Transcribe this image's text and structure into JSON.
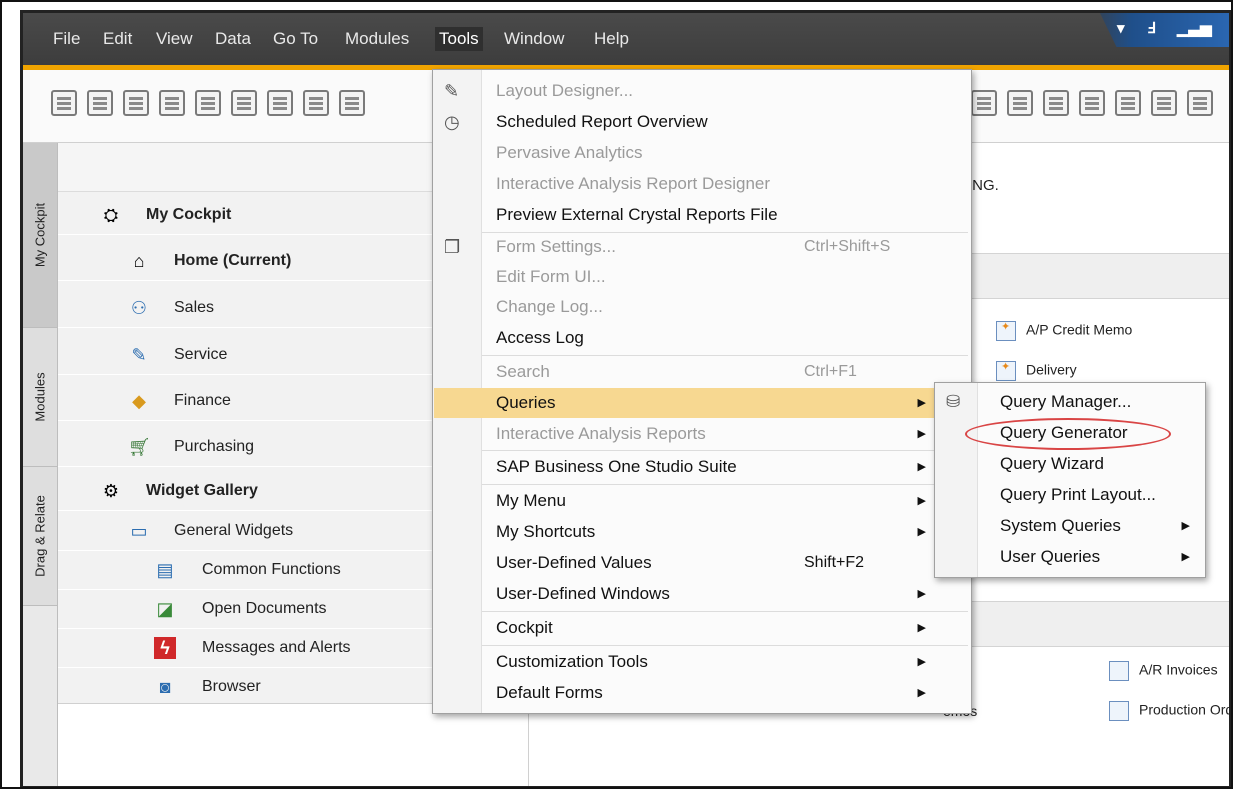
{
  "menubar": {
    "items": [
      "File",
      "Edit",
      "View",
      "Data",
      "Go To",
      "Modules",
      "Tools",
      "Window",
      "Help"
    ],
    "open_item": "Tools"
  },
  "toolbar_icons": [
    "print-preview-icon",
    "print-icon",
    "email-icon",
    "export-icon",
    "calculator-icon",
    "excel-export-icon",
    "word-export-icon",
    "pdf-export-icon",
    "launch-icon"
  ],
  "side_tabs": [
    "My Cockpit",
    "Modules",
    "Drag & Relate"
  ],
  "cockpit": {
    "title": "My Cockpit",
    "items": [
      {
        "label": "Home (Current)",
        "icon": "home-icon",
        "bold": true
      },
      {
        "label": "Sales",
        "icon": "sales-icon"
      },
      {
        "label": "Service",
        "icon": "service-icon"
      },
      {
        "label": "Finance",
        "icon": "finance-icon"
      },
      {
        "label": "Purchasing",
        "icon": "purchasing-icon"
      }
    ],
    "widget_gallery": "Widget Gallery",
    "general_widgets": "General Widgets",
    "widgets": [
      {
        "label": "Common Functions",
        "icon": "common-functions-icon"
      },
      {
        "label": "Open Documents",
        "icon": "open-documents-icon"
      },
      {
        "label": "Messages and Alerts",
        "icon": "messages-alerts-icon"
      },
      {
        "label": "Browser",
        "icon": "browser-icon"
      }
    ]
  },
  "content": {
    "notice": "AINING.",
    "docs": [
      "A/P Credit Memo",
      "Delivery",
      "A/R Invoices",
      "emos",
      "Production Ord"
    ]
  },
  "tools_menu": [
    {
      "label": "Layout Designer...",
      "disabled": true,
      "icon": "layout-designer-icon"
    },
    {
      "label": "Scheduled Report Overview",
      "disabled": false,
      "icon": "scheduled-report-icon"
    },
    {
      "label": "Pervasive Analytics",
      "disabled": true
    },
    {
      "label": "Interactive Analysis Report Designer",
      "disabled": true
    },
    {
      "label": "Preview External Crystal Reports File",
      "disabled": false
    },
    {
      "label": "Form Settings...",
      "disabled": true,
      "shortcut": "Ctrl+Shift+S",
      "icon": "form-settings-icon"
    },
    {
      "label": "Edit Form UI...",
      "disabled": true
    },
    {
      "label": "Change Log...",
      "disabled": true
    },
    {
      "label": "Access Log",
      "disabled": false
    },
    {
      "label": "Search",
      "disabled": true,
      "shortcut": "Ctrl+F1"
    },
    {
      "label": "Queries",
      "disabled": false,
      "submenu": true,
      "highlight": true
    },
    {
      "label": "Interactive Analysis Reports",
      "disabled": true,
      "submenu": true
    },
    {
      "label": "SAP Business One Studio Suite",
      "disabled": false,
      "submenu": true
    },
    {
      "label": "My Menu",
      "disabled": false,
      "submenu": true
    },
    {
      "label": "My Shortcuts",
      "disabled": false,
      "submenu": true
    },
    {
      "label": "User-Defined Values",
      "disabled": false,
      "shortcut": "Shift+F2"
    },
    {
      "label": "User-Defined Windows",
      "disabled": false,
      "submenu": true
    },
    {
      "label": "Cockpit",
      "disabled": false,
      "submenu": true
    },
    {
      "label": "Customization Tools",
      "disabled": false,
      "submenu": true
    },
    {
      "label": "Default Forms",
      "disabled": false,
      "submenu": true
    }
  ],
  "queries_menu": [
    {
      "label": "Query Manager...",
      "icon": "query-manager-icon"
    },
    {
      "label": "Query Generator",
      "circled": true
    },
    {
      "label": "Query Wizard"
    },
    {
      "label": "Query Print Layout..."
    },
    {
      "label": "System Queries",
      "submenu": true
    },
    {
      "label": "User Queries",
      "submenu": true
    }
  ]
}
